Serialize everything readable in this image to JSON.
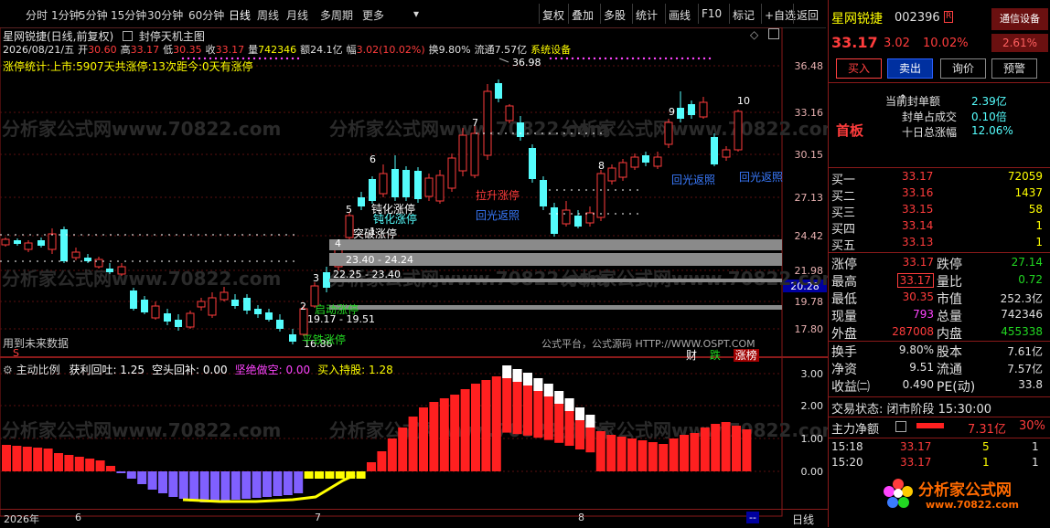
{
  "menu": {
    "periods": [
      "分时",
      "1分钟",
      "5分钟",
      "15分钟",
      "30分钟",
      "60分钟",
      "日线",
      "周线",
      "月线",
      "多周期",
      "更多"
    ],
    "active": "日线",
    "tools": [
      "复权",
      "叠加",
      "多股",
      "统计",
      "画线",
      "F10",
      "标记",
      "+自选",
      "返回"
    ]
  },
  "chart": {
    "title": "星网锐捷(日线,前复权)",
    "main_indicator": "封停天机主图",
    "ohlc_line": {
      "date": "2026/08/21/五",
      "open_lbl": "开",
      "open": "30.60",
      "high_lbl": "高",
      "high": "33.17",
      "low_lbl": "低",
      "low": "30.35",
      "close_lbl": "收",
      "close": "33.17",
      "vol_lbl": "量",
      "vol": "742346",
      "amt_lbl": "额",
      "amt": "24.1亿",
      "amp_lbl": "幅",
      "amp": "3.02(10.02%)",
      "turn_lbl": "换",
      "turn": "9.80%",
      "float_lbl": "流通",
      "float": "7.57亿",
      "sys": "系统设备"
    },
    "limit_stats": "涨停统计:上市:5907天共涨停:13次距今:0天有涨停",
    "future_note": "用到未来数据",
    "s_marker": "S",
    "platform_note": "公式平台，公式源码 HTTP://WWW.OSPT.COM",
    "bottom_tags": [
      "财",
      "跌",
      "涨榜"
    ],
    "watermark": "分析家公式网www.70822.com",
    "price_axis": [
      "36.48",
      "33.16",
      "30.15",
      "27.13",
      "24.42",
      "21.98",
      "19.78",
      "17.80"
    ],
    "price_tag": "20.28",
    "high_marker": "36.98",
    "annotations": [
      {
        "text": "钝化涨停",
        "color": "#ffffff"
      },
      {
        "text": "钝化涨停",
        "color": "#5ff"
      },
      {
        "text": "突破涨停",
        "color": "#ffffff"
      },
      {
        "text": "拉升涨停",
        "color": "#ff3c3c"
      },
      {
        "text": "回光返照",
        "color": "#3a7bff"
      },
      {
        "text": "回光返照",
        "color": "#3a7bff"
      },
      {
        "text": "回光返照",
        "color": "#3a7bff"
      },
      {
        "text": "启动涨停",
        "color": "#22d822"
      },
      {
        "text": "平铁涨停",
        "color": "#22d822"
      }
    ],
    "bands": [
      "23.40 - 24.24",
      "22.25 - 23.40",
      "19.17 - 19.51",
      "16.86"
    ],
    "counts": [
      "1",
      "2",
      "3",
      "4",
      "5",
      "6",
      "7",
      "8",
      "9",
      "10"
    ]
  },
  "indicator": {
    "name": "主动比例",
    "items": [
      {
        "label": "获利回吐: 1.25",
        "color": "#ffffff"
      },
      {
        "label": "空头回补: 0.00",
        "color": "#ffffff"
      },
      {
        "label": "坚绝做空: 0.00",
        "color": "#ff44ff"
      },
      {
        "label": "买入持股: 1.28",
        "color": "#ffff00"
      }
    ],
    "axis": [
      "3.00",
      "2.00",
      "1.00",
      "0.00"
    ]
  },
  "time_axis": {
    "labels": [
      "2026年",
      "6",
      "7",
      "8"
    ],
    "mode": "日线",
    "end": "--"
  },
  "panel": {
    "name": "星网锐捷",
    "code": "002396",
    "r_tag": "R",
    "notice": "通信设备",
    "price": "33.17",
    "change": "3.02",
    "pct": "10.02%",
    "side_pct": "2.61%",
    "buttons": [
      "买入",
      "卖出",
      "询价",
      "预警"
    ],
    "seal": [
      {
        "label": "当前封单额",
        "value": "2.39亿"
      },
      {
        "label": "封单占成交",
        "value": "0.10倍"
      },
      {
        "label": "十日总涨幅",
        "value": "12.06%"
      }
    ],
    "board": "首板",
    "sells": [
      {
        "label": "卖五",
        "price": "",
        "vol": ""
      },
      {
        "label": "卖四",
        "price": "",
        "vol": ""
      },
      {
        "label": "卖三",
        "price": "",
        "vol": ""
      },
      {
        "label": "卖二",
        "price": "",
        "vol": ""
      },
      {
        "label": "卖一",
        "price": "",
        "vol": ""
      }
    ],
    "buys": [
      {
        "label": "买一",
        "price": "33.17",
        "vol": "72059"
      },
      {
        "label": "买二",
        "price": "33.16",
        "vol": "1437"
      },
      {
        "label": "买三",
        "price": "33.15",
        "vol": "58"
      },
      {
        "label": "买四",
        "price": "33.14",
        "vol": "1"
      },
      {
        "label": "买五",
        "price": "33.13",
        "vol": "1"
      }
    ],
    "stats": [
      {
        "l1": "涨停",
        "v1": "33.17",
        "c1": "#ff3c3c",
        "l2": "跌停",
        "v2": "27.14",
        "c2": "#22d822"
      },
      {
        "l1": "最高",
        "v1": "33.17",
        "c1": "#ff3c3c",
        "l2": "量比",
        "v2": "0.72",
        "c2": "#22d822"
      },
      {
        "l1": "最低",
        "v1": "30.35",
        "c1": "#ff3c3c",
        "l2": "市值",
        "v2": "252.3亿",
        "c2": "#e0e0e0"
      },
      {
        "l1": "现量",
        "v1": "793",
        "c1": "#ff44ff",
        "l2": "总量",
        "v2": "742346",
        "c2": "#e0e0e0"
      },
      {
        "l1": "外盘",
        "v1": "287008",
        "c1": "#ff3c3c",
        "l2": "内盘",
        "v2": "455338",
        "c2": "#22d822"
      }
    ],
    "fin": [
      {
        "l1": "换手",
        "v1": "9.80%",
        "l2": "股本",
        "v2": "7.61亿"
      },
      {
        "l1": "净资",
        "v1": "9.51",
        "l2": "流通",
        "v2": "7.57亿"
      },
      {
        "l1": "收益㈡",
        "v1": "0.490",
        "l2": "PE(动)",
        "v2": "33.8"
      }
    ],
    "trade_state": "交易状态: 闭市阶段 15:30:00",
    "main_net": {
      "label": "主力净额",
      "value": "7.31亿",
      "pct": "30%"
    },
    "ticks": [
      {
        "time": "15:18",
        "price": "33.17",
        "vol": "5",
        "n": "1"
      },
      {
        "time": "15:20",
        "price": "33.17",
        "vol": "1",
        "n": "1"
      }
    ],
    "logo": "分析家公式网",
    "logo_url": "www.70822.com"
  }
}
